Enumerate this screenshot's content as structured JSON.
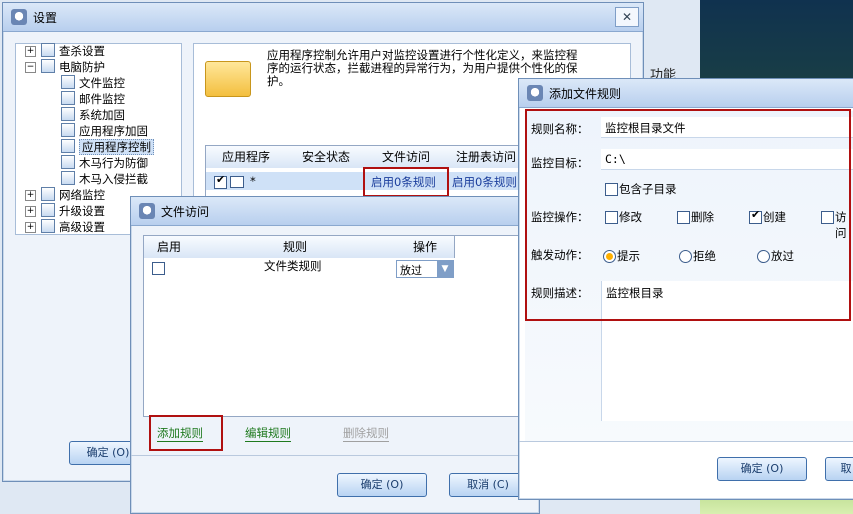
{
  "desktop": {
    "right_text": "功能"
  },
  "settings": {
    "title": "设置",
    "tree": [
      {
        "label": "查杀设置"
      },
      {
        "label": "电脑防护"
      },
      {
        "label": "文件监控"
      },
      {
        "label": "邮件监控"
      },
      {
        "label": "系统加固"
      },
      {
        "label": "应用程序加固"
      },
      {
        "label": "应用程序控制"
      },
      {
        "label": "木马行为防御"
      },
      {
        "label": "木马入侵拦截"
      },
      {
        "label": "网络监控"
      },
      {
        "label": "升级设置"
      },
      {
        "label": "高级设置"
      }
    ],
    "description": "应用程序控制允许用户对监控设置进行个性化定义，来监控程序的运行状态，拦截进程的异常行为，为用户提供个性化的保护。",
    "table_headers": [
      "应用程序",
      "安全状态",
      "文件访问",
      "注册表访问"
    ],
    "row": {
      "app": "*",
      "file_access": "启用0条规则",
      "reg_access": "启用0条规则"
    },
    "ok_button": "确定 (O)"
  },
  "file_access": {
    "title": "文件访问",
    "headers": [
      "启用",
      "规则",
      "操作"
    ],
    "row": {
      "rule": "文件类规则",
      "action": "放过"
    },
    "add_rule": "添加规则",
    "edit_rule": "编辑规则",
    "delete_rule": "删除规则",
    "ok_button": "确定 (O)",
    "cancel_button": "取消 (C)"
  },
  "add_rule": {
    "title": "添加文件规则",
    "name_label": "规则名称：",
    "name_value": "监控根目录文件",
    "target_label": "监控目标：",
    "target_value": "C:\\",
    "subdir_label": "包含子目录",
    "operation_label": "监控操作：",
    "ops": [
      "修改",
      "删除",
      "创建",
      "访问"
    ],
    "trigger_label": "触发动作：",
    "actions": [
      "提示",
      "拒绝",
      "放过"
    ],
    "desc_label": "规则描述：",
    "desc_value": "监控根目录",
    "ok_button": "确定 (O)",
    "cancel_button": "取"
  }
}
